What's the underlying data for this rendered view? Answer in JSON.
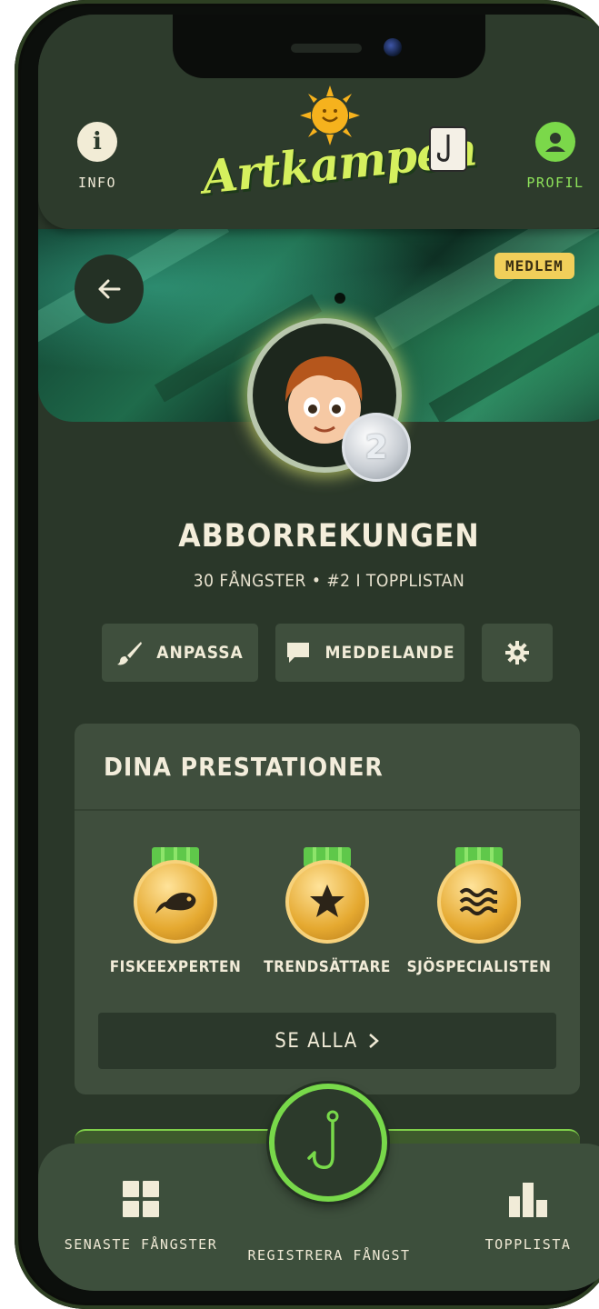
{
  "header": {
    "info_label": "INFO",
    "profile_label": "PROFIL",
    "logo_text": "Artkampen",
    "info_icon": "info-icon",
    "profile_icon": "user-icon"
  },
  "banner": {
    "member_badge": "MEDLEM",
    "rank": "2"
  },
  "profile": {
    "username": "ABBORREKUNGEN",
    "stats": "30 FÅNGSTER • #2 I TOPPLISTAN"
  },
  "actions": {
    "customize": "ANPASSA",
    "message": "MEDDELANDE"
  },
  "achievements": {
    "title": "DINA PRESTATIONER",
    "items": [
      {
        "name": "FISKEEXPERTEN",
        "icon": "fish-icon"
      },
      {
        "name": "TRENDSÄTTARE",
        "icon": "star-icon"
      },
      {
        "name": "SJÖSPECIALISTEN",
        "icon": "waves-icon"
      }
    ],
    "see_all": "SE ALLA"
  },
  "bottom_nav": {
    "latest": "SENASTE FÅNGSTER",
    "register": "REGISTRERA FÅNGST",
    "toplist": "TOPPLISTA"
  },
  "colors": {
    "accent_green": "#7bd84a",
    "background": "#2a3729",
    "badge_yellow": "#f1cf5a"
  }
}
